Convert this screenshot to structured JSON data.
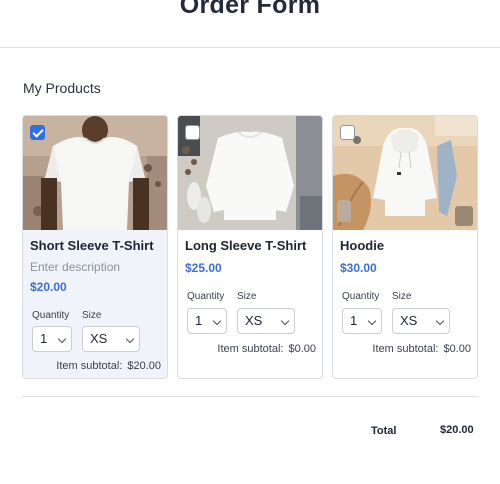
{
  "header": {
    "title": "Order Form"
  },
  "section": {
    "label": "My Products"
  },
  "products": [
    {
      "name": "Short Sleeve T-Shirt",
      "description_placeholder": "Enter description",
      "price": "$20.00",
      "selected": true,
      "quantity_label": "Quantity",
      "quantity": "1",
      "size_label": "Size",
      "size": "XS",
      "subtotal_label": "Item subtotal:",
      "subtotal": "$20.00",
      "image_icon": "tshirt-photo-icon"
    },
    {
      "name": "Long Sleeve T-Shirt",
      "price": "$25.00",
      "selected": false,
      "quantity_label": "Quantity",
      "quantity": "1",
      "size_label": "Size",
      "size": "XS",
      "subtotal_label": "Item subtotal:",
      "subtotal": "$0.00",
      "image_icon": "sweatshirt-photo-icon"
    },
    {
      "name": "Hoodie",
      "price": "$30.00",
      "selected": false,
      "quantity_label": "Quantity",
      "quantity": "1",
      "size_label": "Size",
      "size": "XS",
      "subtotal_label": "Item subtotal:",
      "subtotal": "$0.00",
      "image_icon": "hoodie-photo-icon"
    }
  ],
  "summary": {
    "total_label": "Total",
    "total": "$20.00"
  },
  "colors": {
    "accent": "#2f6fe0",
    "price": "#3a6fd8",
    "selected_card_bg": "#f1f3fb"
  }
}
